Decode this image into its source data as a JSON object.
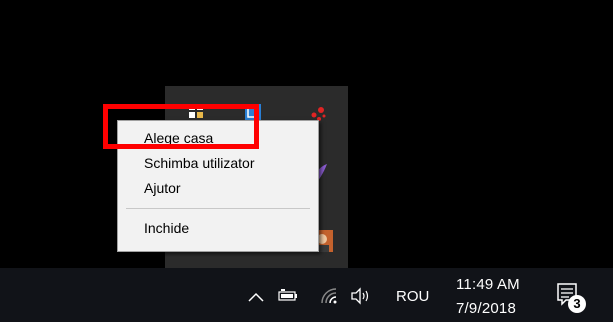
{
  "context_menu": {
    "items": [
      "Alege casa",
      "Schimba utilizator",
      "Ajutor",
      "Inchide"
    ]
  },
  "taskbar": {
    "language": "ROU",
    "time": "11:49 AM",
    "date": "7/9/2018",
    "notification_count": "3"
  },
  "colors": {
    "highlight": "#ff0000",
    "menu_bg": "#f2f2f2",
    "taskbar_bg": "#111318"
  },
  "icons": {
    "tray_up": "chevron-up-icon",
    "battery": "battery-icon",
    "wifi": "wifi-icon",
    "volume": "volume-icon",
    "notifications": "action-center-icon"
  }
}
